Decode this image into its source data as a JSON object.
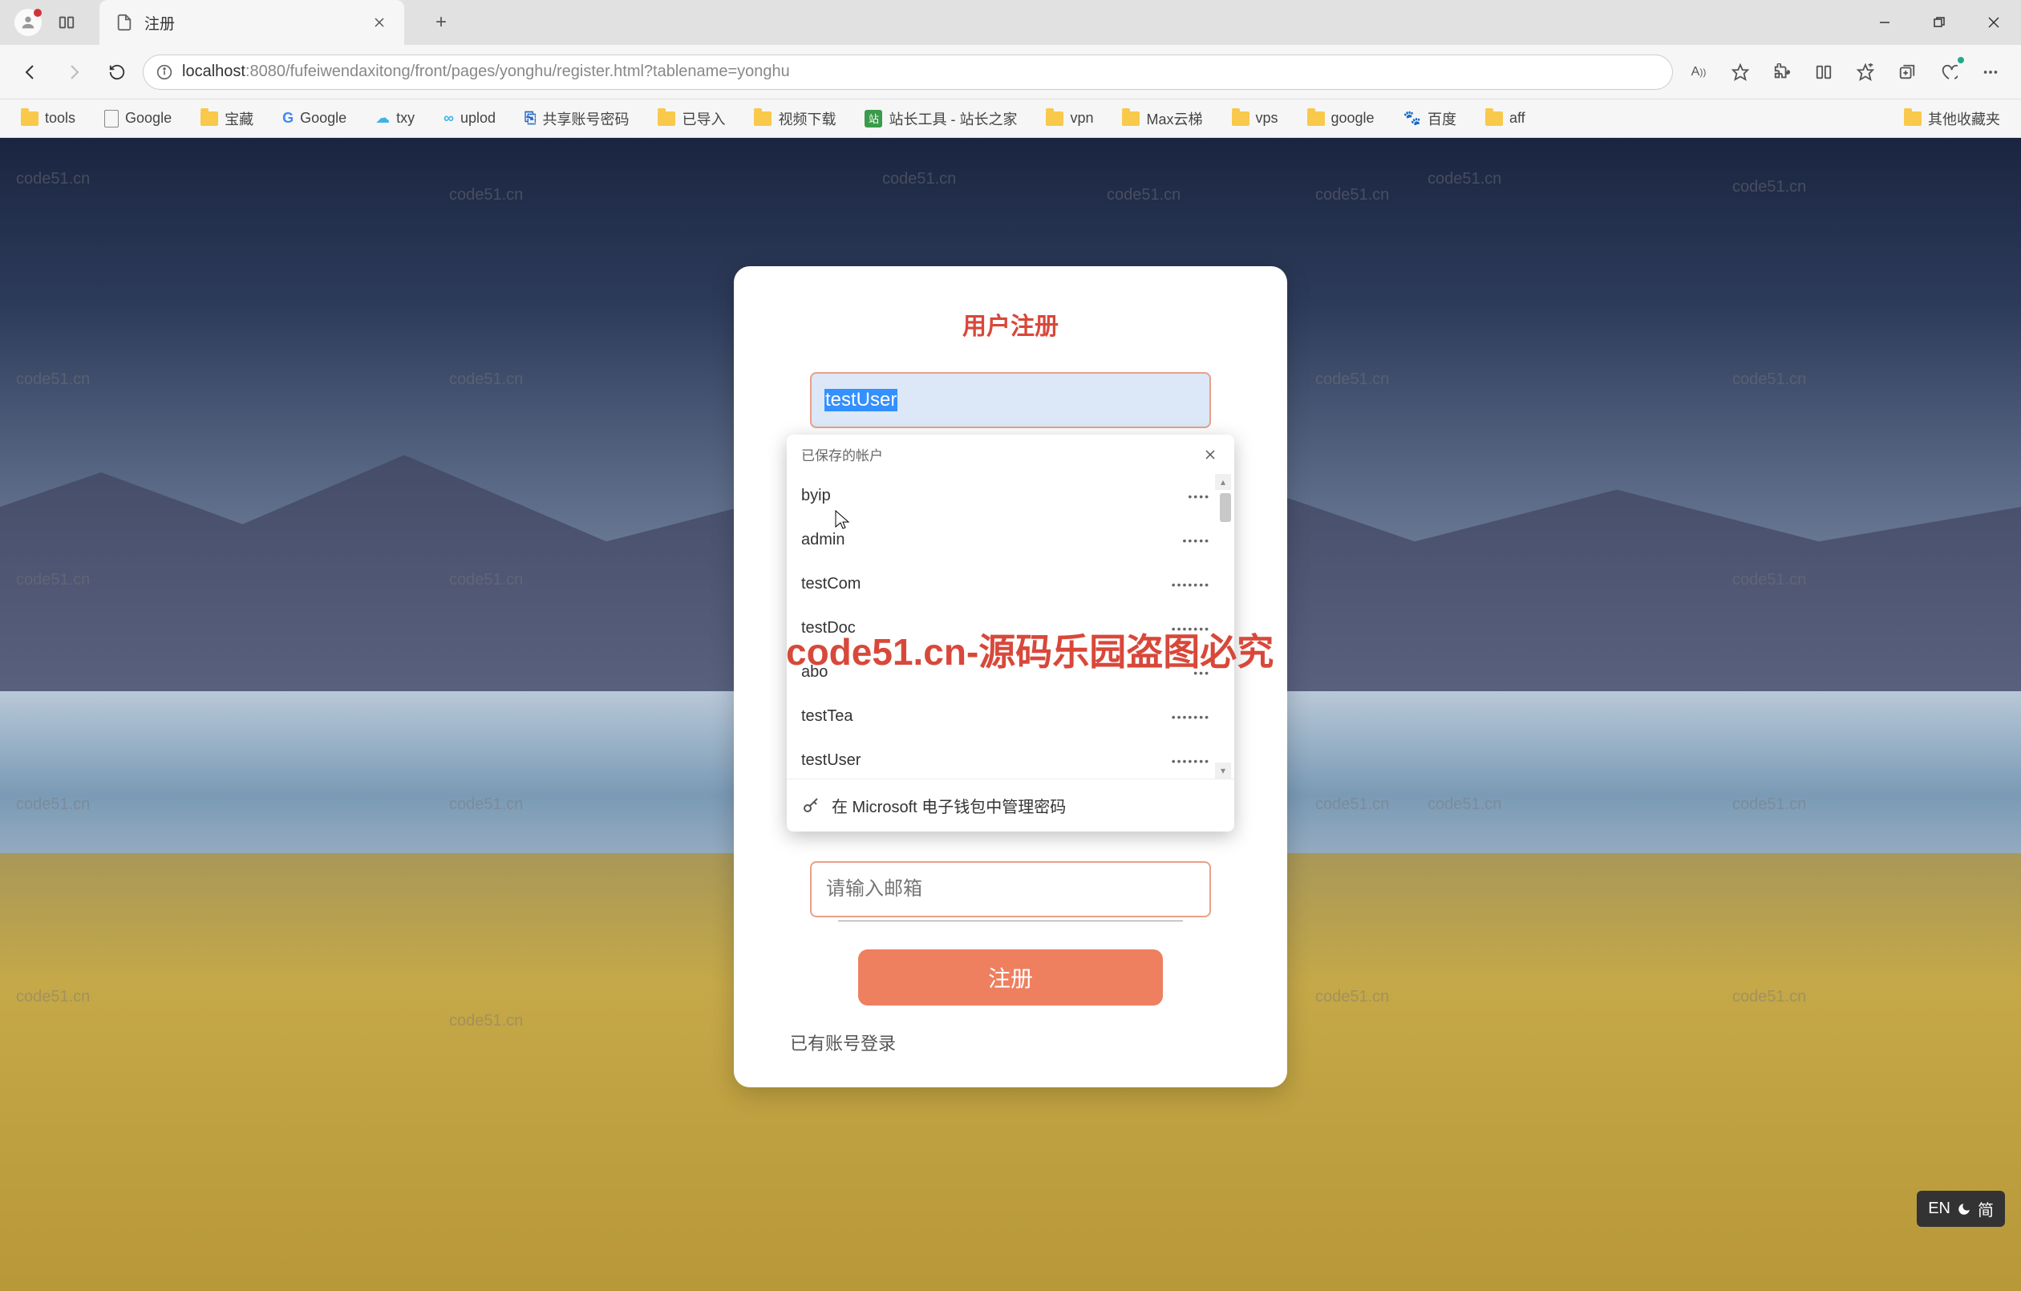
{
  "titlebar": {
    "tab_title": "注册"
  },
  "addressbar": {
    "url_prefix": "localhost",
    "url_rest": ":8080/fufeiwendaxitong/front/pages/yonghu/register.html?tablename=yonghu"
  },
  "bookmarks": [
    {
      "icon": "folder",
      "label": "tools"
    },
    {
      "icon": "page",
      "label": "Google"
    },
    {
      "icon": "folder",
      "label": "宝藏"
    },
    {
      "icon": "google",
      "label": "Google"
    },
    {
      "icon": "cloud",
      "label": "txy"
    },
    {
      "icon": "uplod",
      "label": "uplod"
    },
    {
      "icon": "share",
      "label": "共享账号密码"
    },
    {
      "icon": "folder",
      "label": "已导入"
    },
    {
      "icon": "folder",
      "label": "视频下载"
    },
    {
      "icon": "zhanzhang",
      "label": "站长工具 - 站长之家"
    },
    {
      "icon": "folder",
      "label": "vpn"
    },
    {
      "icon": "folder",
      "label": "Max云梯"
    },
    {
      "icon": "folder",
      "label": "vps"
    },
    {
      "icon": "folder",
      "label": "google"
    },
    {
      "icon": "baidu",
      "label": "百度"
    },
    {
      "icon": "folder",
      "label": "aff"
    }
  ],
  "bookmarks_right": [
    {
      "icon": "folder",
      "label": "其他收藏夹"
    }
  ],
  "register": {
    "title": "用户注册",
    "username_value": "testUser",
    "email_placeholder": "请输入邮箱",
    "submit": "注册",
    "login_link": "已有账号登录"
  },
  "autofill": {
    "header": "已保存的帐户",
    "items": [
      {
        "user": "byip",
        "pw": "••••"
      },
      {
        "user": "admin",
        "pw": "•••••"
      },
      {
        "user": "testCom",
        "pw": "•••••••"
      },
      {
        "user": "testDoc",
        "pw": "•••••••"
      },
      {
        "user": "abo",
        "pw": "•••"
      },
      {
        "user": "testTea",
        "pw": "•••••••"
      },
      {
        "user": "testUser",
        "pw": "•••••••"
      }
    ],
    "footer": "在 Microsoft 电子钱包中管理密码"
  },
  "watermarks": {
    "text": "code51.cn",
    "big": "code51.cn-源码乐园盗图必究"
  },
  "ime": {
    "lang": "EN",
    "mode": "简"
  }
}
